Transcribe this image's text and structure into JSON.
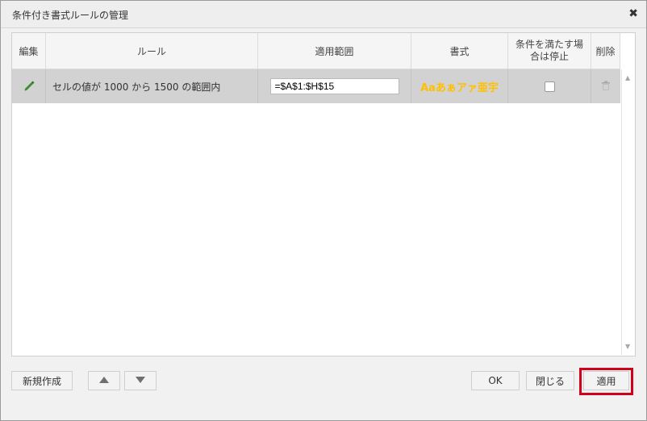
{
  "dialog": {
    "title": "条件付き書式ルールの管理",
    "close_symbol": "✖"
  },
  "table": {
    "headers": {
      "edit": "編集",
      "rule": "ルール",
      "range": "適用範囲",
      "format": "書式",
      "stop_if_true": "条件を満たす場合は停止",
      "delete": "削除"
    },
    "rows": [
      {
        "rule_text": "セルの値が 1000 から 1500 の範囲内",
        "range_value": "=$A$1:$H$15",
        "format_sample": "Aaあぁアァ亜宇",
        "stop_checked": false
      }
    ]
  },
  "footer": {
    "new_label": "新規作成",
    "ok_label": "OK",
    "close_label": "閉じる",
    "apply_label": "適用"
  },
  "colors": {
    "highlight": "#d0021b",
    "sample_text": "#ffc000",
    "row_bg": "#d2d2d2"
  }
}
